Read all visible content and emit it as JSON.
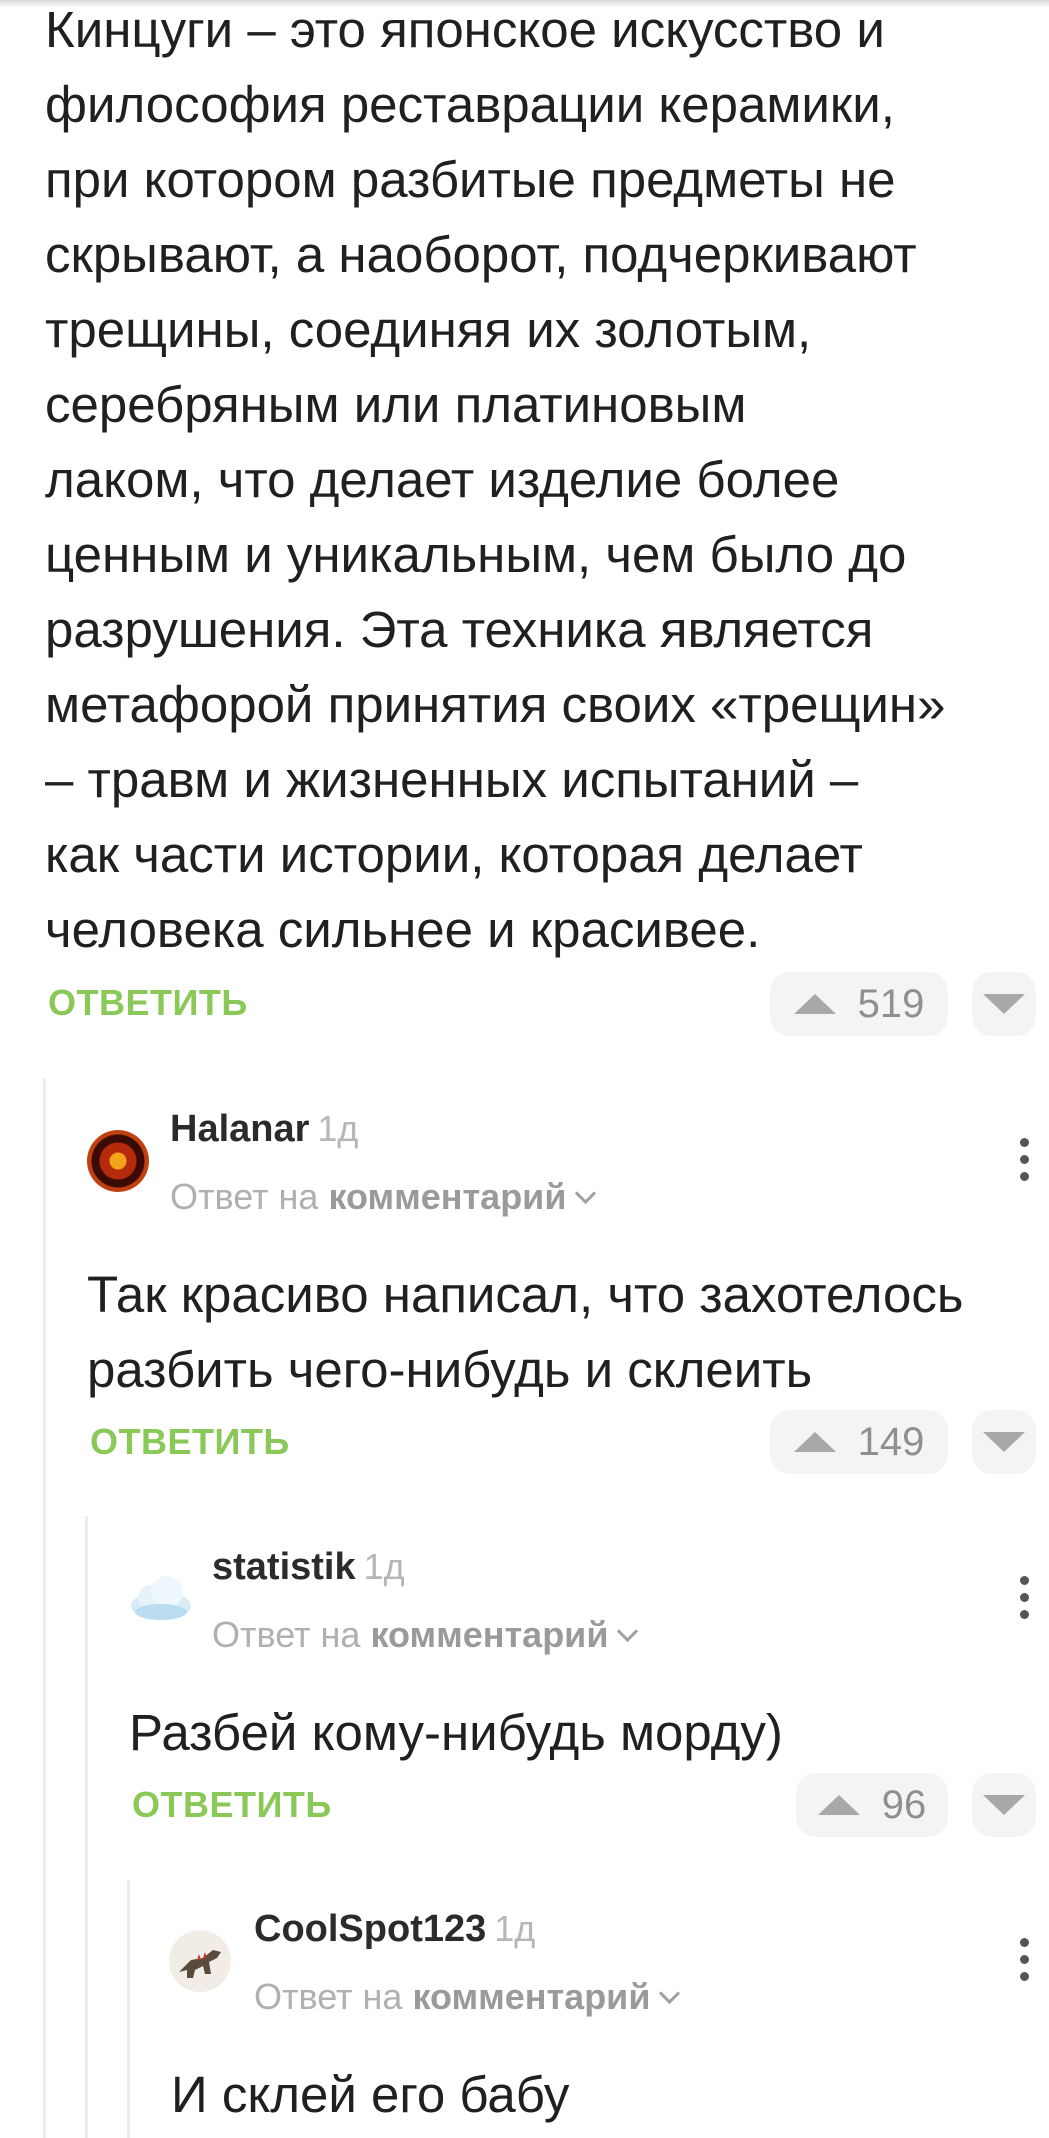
{
  "main_comment": {
    "text_lines": [
      "Кинцуги – это японское искусство и",
      "философия реставрации керамики,",
      "при котором разбитые предметы не",
      "скрывают, а наоборот, подчеркивают",
      "трещины, соединяя их золотым,",
      "серебряным или платиновым",
      "лаком, что делает изделие более",
      "ценным и уникальным, чем было до",
      "разрушения. Эта техника является",
      "метафорой принятия своих «трещин»",
      "– травм и жизненных испытаний –",
      "как части истории, которая делает",
      "человека сильнее и красивее."
    ],
    "reply_label": "ОТВЕТИТЬ",
    "rating": "519"
  },
  "comments": [
    {
      "username": "Halanar",
      "time": "1д",
      "reply_to_prefix": "Ответ на",
      "reply_to_link": "комментарий",
      "text_lines": [
        "Так красиво написал, что захотелось",
        "разбить чего-нибудь и склеить"
      ],
      "reply_label": "ОТВЕТИТЬ",
      "rating": "149"
    },
    {
      "username": "statistik",
      "time": "1д",
      "reply_to_prefix": "Ответ на",
      "reply_to_link": "комментарий",
      "text_lines": [
        "Разбей кому-нибудь морду)"
      ],
      "reply_label": "ОТВЕТИТЬ",
      "rating": "96"
    },
    {
      "username": "CoolSpot123",
      "time": "1д",
      "reply_to_prefix": "Ответ на",
      "reply_to_link": "комментарий",
      "text_lines": [
        "И склей его бабу"
      ]
    }
  ],
  "colors": {
    "reply_green": "#8ac858",
    "vote_gray": "#a8a8a8",
    "thread_line": "#ececec"
  },
  "icons": [
    "vote-up-icon",
    "vote-down-icon",
    "kebab-menu-icon",
    "chevron-down-icon"
  ]
}
